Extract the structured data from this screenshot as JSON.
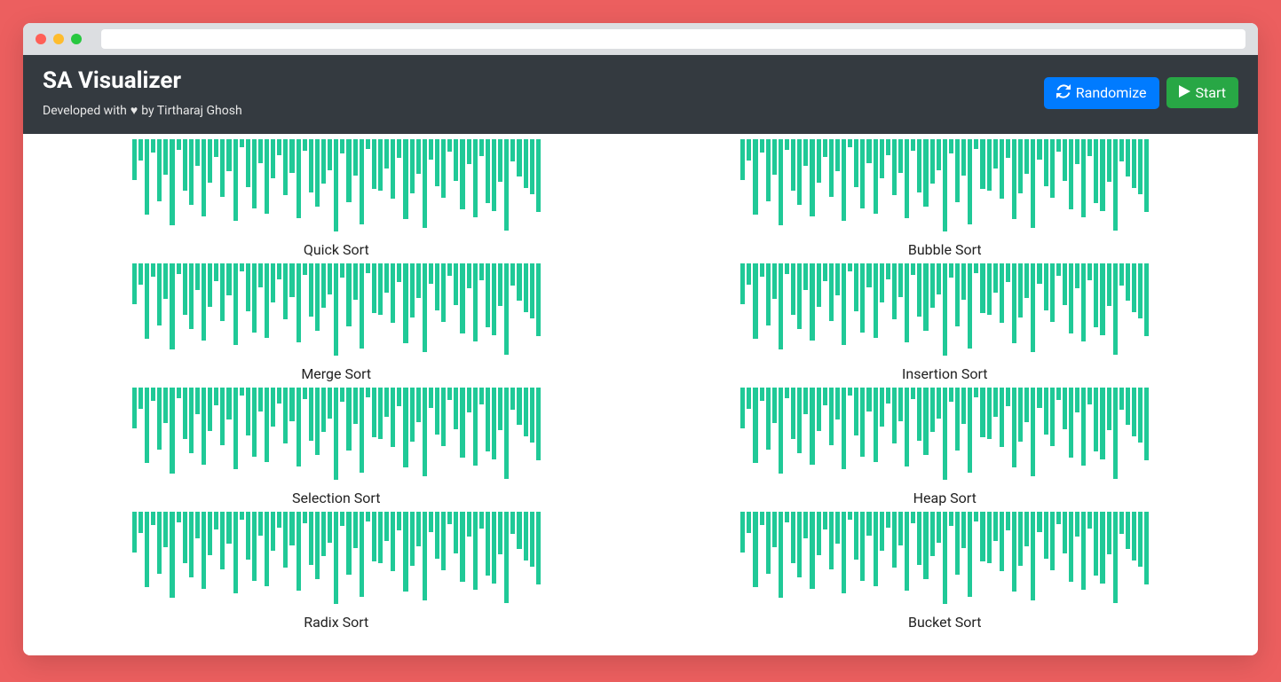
{
  "brand": "SA Visualizer",
  "subtitle_prefix": "Developed with",
  "subtitle_suffix": "by Tirtharaj Ghosh",
  "buttons": {
    "randomize": "Randomize",
    "start": "Start"
  },
  "colors": {
    "bar": "#20c997",
    "navbar": "#343a40",
    "primary": "#007bff",
    "success": "#28a745",
    "page_bg": "#ec5f5f"
  },
  "bar_values": [
    44,
    23,
    81,
    14,
    67,
    38,
    92,
    11,
    55,
    70,
    29,
    83,
    47,
    19,
    62,
    34,
    88,
    9,
    51,
    74,
    26,
    80,
    42,
    17,
    60,
    36,
    85,
    12,
    57,
    72,
    48,
    33,
    99,
    15,
    68,
    39,
    91,
    10,
    53,
    55,
    31,
    64,
    20,
    86,
    58,
    37,
    95,
    22,
    50,
    63,
    13,
    45,
    75,
    27,
    84,
    18,
    69,
    77,
    46,
    98,
    24,
    40,
    52,
    59,
    78
  ],
  "panels": [
    {
      "label": "Quick Sort"
    },
    {
      "label": "Bubble Sort"
    },
    {
      "label": "Merge Sort"
    },
    {
      "label": "Insertion Sort"
    },
    {
      "label": "Selection Sort"
    },
    {
      "label": "Heap Sort"
    },
    {
      "label": "Radix Sort"
    },
    {
      "label": "Bucket Sort"
    }
  ]
}
